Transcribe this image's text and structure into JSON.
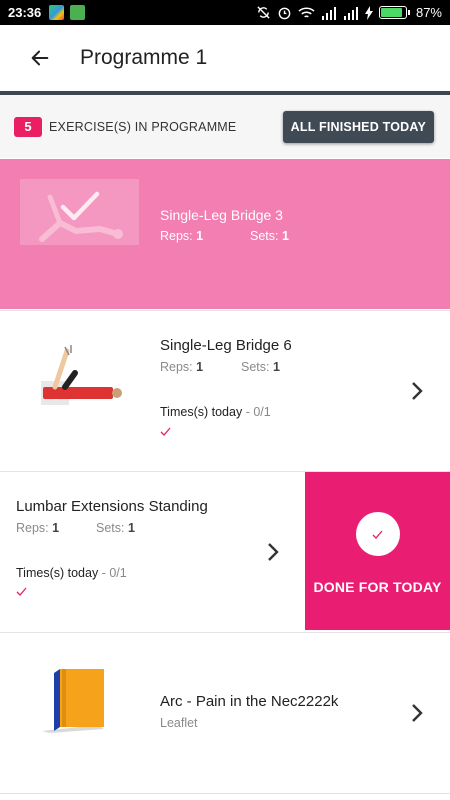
{
  "status_bar": {
    "time": "23:36",
    "battery": "87%",
    "battery_level": 0.87
  },
  "header": {
    "title": "Programme 1"
  },
  "summary": {
    "count": "5",
    "label": "EXERCISE(S) IN PROGRAMME",
    "finish_button": "ALL FINISHED TODAY"
  },
  "labels": {
    "reps": "Reps:",
    "sets": "Sets:",
    "times_today": "Times(s) today"
  },
  "exercises": [
    {
      "name": "Single-Leg Bridge 3",
      "reps": "1",
      "sets": "1"
    },
    {
      "name": "Single-Leg Bridge 6",
      "reps": "1",
      "sets": "1",
      "times_value": "- 0/1"
    },
    {
      "name": "Lumbar Extensions Standing",
      "reps": "1",
      "sets": "1",
      "times_value": "- 0/1",
      "done_label": "DONE FOR TODAY"
    },
    {
      "name": "Arc - Pain in the Nec2222k",
      "subtitle": "Leaflet"
    }
  ],
  "colors": {
    "pink": "#e91e63",
    "pink_light": "#f37eb1",
    "dark": "#3f4a55"
  }
}
